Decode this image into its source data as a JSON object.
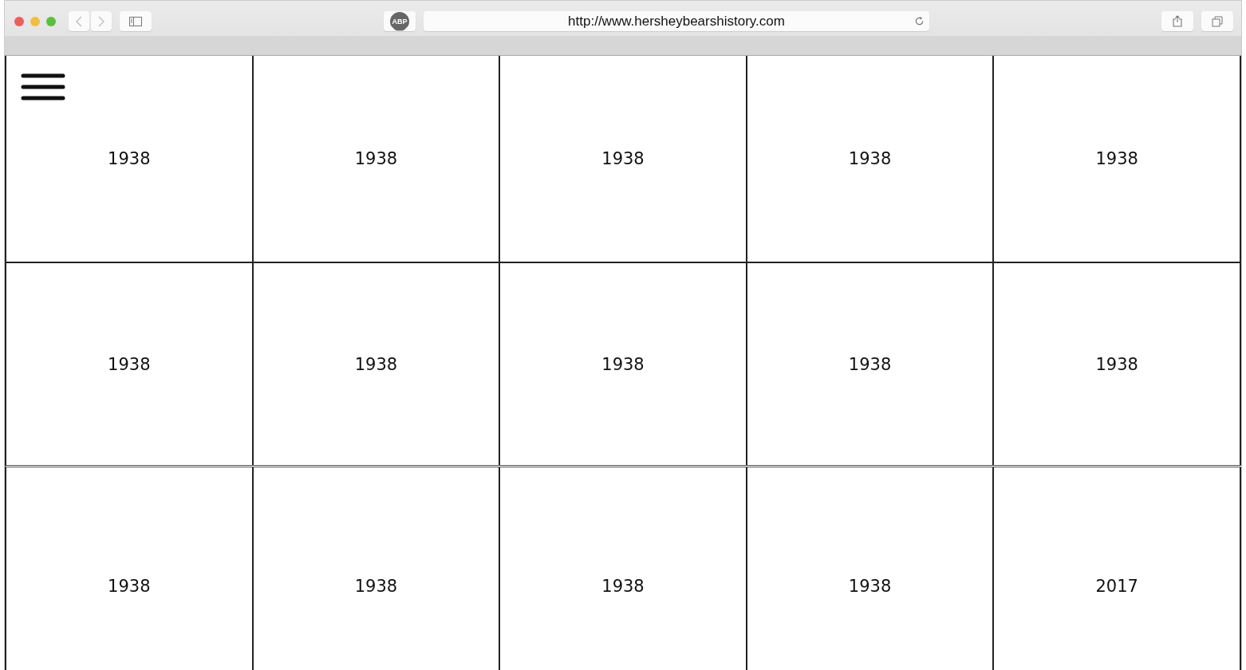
{
  "browser": {
    "adblock_label": "ABP",
    "url": "http://www.hersheybearshistory.com"
  },
  "grid": {
    "rows": [
      [
        "1938",
        "1938",
        "1938",
        "1938",
        "1938"
      ],
      [
        "1938",
        "1938",
        "1938",
        "1938",
        "1938"
      ],
      [
        "1938",
        "1938",
        "1938",
        "1938",
        "2017"
      ]
    ]
  }
}
